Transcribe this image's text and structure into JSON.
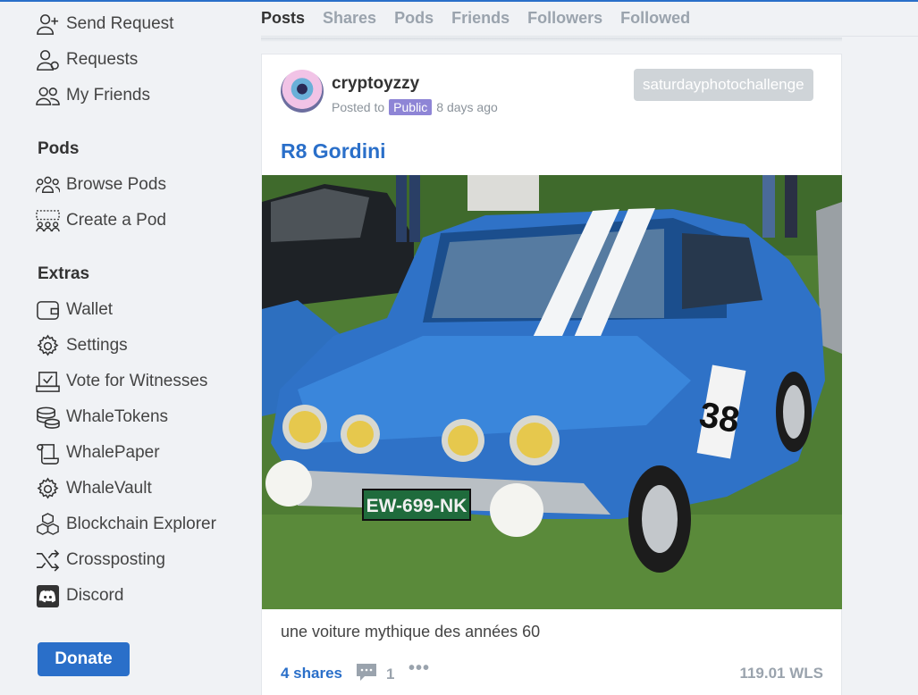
{
  "colors": {
    "accent": "#2a6fc9",
    "badge": "#8e85d6",
    "tag": "#cfd4d8",
    "muted": "#9aa3ad"
  },
  "sidebar": {
    "items_top": [
      {
        "label": "Send Request",
        "icon": "user-plus-icon"
      },
      {
        "label": "Requests",
        "icon": "user-requests-icon"
      },
      {
        "label": "My Friends",
        "icon": "users-icon"
      }
    ],
    "pods_title": "Pods",
    "pods_items": [
      {
        "label": "Browse Pods",
        "icon": "group-icon"
      },
      {
        "label": "Create a Pod",
        "icon": "create-group-icon"
      }
    ],
    "extras_title": "Extras",
    "extras_items": [
      {
        "label": "Wallet",
        "icon": "wallet-icon"
      },
      {
        "label": "Settings",
        "icon": "gear-icon"
      },
      {
        "label": "Vote for Witnesses",
        "icon": "vote-icon"
      },
      {
        "label": "WhaleTokens",
        "icon": "coins-icon"
      },
      {
        "label": "WhalePaper",
        "icon": "scroll-icon"
      },
      {
        "label": "WhaleVault",
        "icon": "gear-vault-icon"
      },
      {
        "label": "Blockchain Explorer",
        "icon": "cubes-icon"
      },
      {
        "label": "Crossposting",
        "icon": "shuffle-icon"
      },
      {
        "label": "Discord",
        "icon": "discord-icon"
      }
    ],
    "donate_label": "Donate"
  },
  "tabs": [
    "Posts",
    "Shares",
    "Pods",
    "Friends",
    "Followers",
    "Followed"
  ],
  "active_tab": "Posts",
  "post": {
    "author": "cryptoyzzy",
    "posted_to_prefix": "Posted to",
    "visibility": "Public",
    "time_ago": "8 days ago",
    "tag": "saturdayphotochallenge",
    "title": "R8 Gordini",
    "plate": "EW-699-NK",
    "number": "38",
    "body": "une voiture mythique des années 60",
    "shares_label": "4 shares",
    "comment_count": "1",
    "more_label": "•••",
    "payout": "119.01 WLS"
  }
}
